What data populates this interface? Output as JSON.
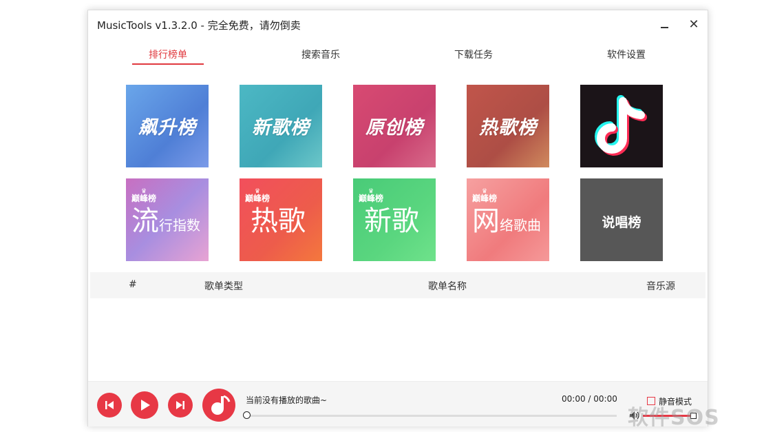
{
  "window": {
    "title": "MusicTools  v1.3.2.0  - 完全免费，请勿倒卖",
    "close_glyph": "✕"
  },
  "tabs": [
    {
      "label": "排行榜单",
      "active": true
    },
    {
      "label": "搜索音乐",
      "active": false
    },
    {
      "label": "下载任务",
      "active": false
    },
    {
      "label": "软件设置",
      "active": false
    }
  ],
  "charts": [
    {
      "label": "飙升榜"
    },
    {
      "label": "新歌榜"
    },
    {
      "label": "原创榜"
    },
    {
      "label": "热歌榜"
    },
    {
      "label": "",
      "icon": "tiktok-logo-icon"
    },
    {
      "badge": "巅峰榜",
      "main": "流",
      "sub": "行指数"
    },
    {
      "badge": "巅峰榜",
      "main": "热歌",
      "sub": ""
    },
    {
      "badge": "巅峰榜",
      "main": "新歌",
      "sub": ""
    },
    {
      "badge": "巅峰榜",
      "main": "网",
      "sub": "络歌曲"
    },
    {
      "label": "说唱榜"
    }
  ],
  "table": {
    "headers": [
      "#",
      "歌单类型",
      "歌单名称",
      "音乐源"
    ]
  },
  "player": {
    "now_playing": "当前没有播放的歌曲~",
    "time": "00:00 / 00:00",
    "mute_label": "静音模式",
    "progress": 0,
    "volume": 1.0
  },
  "watermark": "软件SOS",
  "colors": {
    "accent": "#e0383e",
    "player_red": "#e73845"
  }
}
